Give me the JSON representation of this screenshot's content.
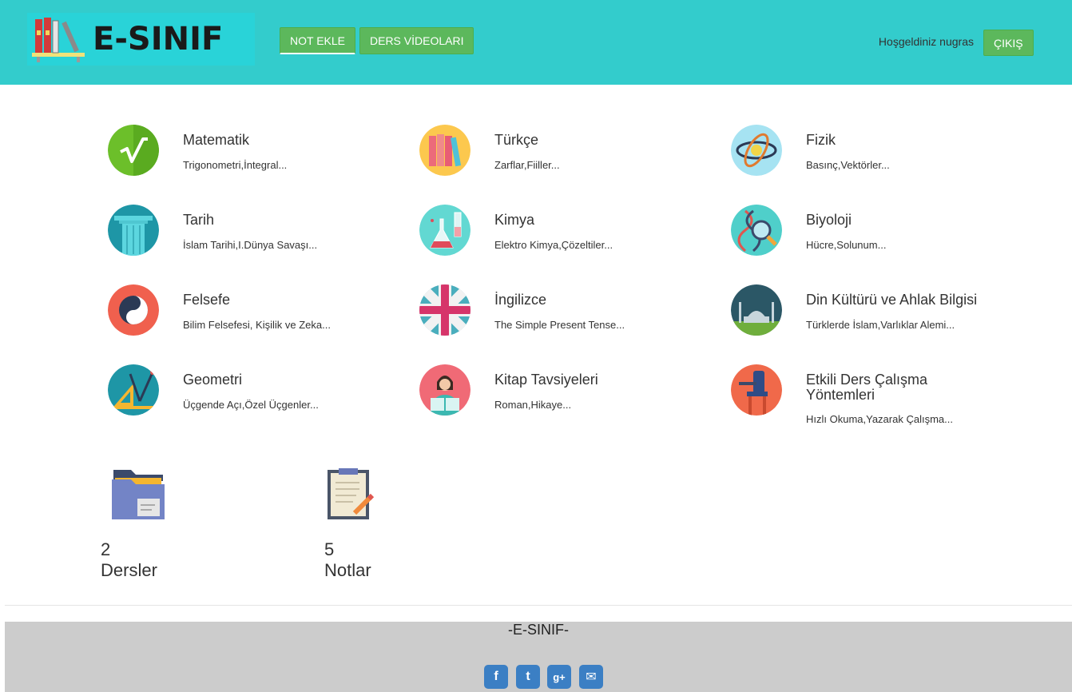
{
  "header": {
    "logo_text": "E-SINIF",
    "nav": [
      {
        "label": "NOT EKLE"
      },
      {
        "label": "DERS VİDEOLARI"
      }
    ],
    "welcome": "Hoşgeldiniz nugras",
    "logout": "ÇIKIŞ"
  },
  "subjects": [
    {
      "title": "Matematik",
      "desc": "Trigonometri,İntegral...",
      "icon": "square-root-icon"
    },
    {
      "title": "Türkçe",
      "desc": "Zarflar,Fiiller...",
      "icon": "books-icon"
    },
    {
      "title": "Fizik",
      "desc": "Basınç,Vektörler...",
      "icon": "atom-icon"
    },
    {
      "title": "Tarih",
      "desc": "İslam Tarihi,I.Dünya Savaşı...",
      "icon": "column-icon"
    },
    {
      "title": "Kimya",
      "desc": "Elektro Kimya,Çözeltiler...",
      "icon": "flask-icon"
    },
    {
      "title": "Biyoloji",
      "desc": "Hücre,Solunum...",
      "icon": "dna-magnifier-icon"
    },
    {
      "title": "Felsefe",
      "desc": "Bilim Felsefesi, Kişilik ve Zeka...",
      "icon": "yin-yang-icon"
    },
    {
      "title": "İngilizce",
      "desc": "The Simple Present Tense...",
      "icon": "uk-flag-icon"
    },
    {
      "title": "Din Kültürü ve Ahlak Bilgisi",
      "desc": "Türklerde İslam,Varlıklar Alemi...",
      "icon": "mosque-icon"
    },
    {
      "title": "Geometri",
      "desc": "Üçgende Açı,Özel Üçgenler...",
      "icon": "set-square-icon"
    },
    {
      "title": "Kitap Tavsiyeleri",
      "desc": "Roman,Hikaye...",
      "icon": "reader-icon"
    },
    {
      "title": "Etkili Ders Çalışma Yöntemleri",
      "desc": "Hızlı Okuma,Yazarak Çalışma...",
      "icon": "desk-chair-icon"
    }
  ],
  "stats": [
    {
      "count": "2",
      "label": "Dersler",
      "icon": "folder-icon"
    },
    {
      "count": "5",
      "label": "Notlar",
      "icon": "clipboard-icon"
    }
  ],
  "footer": {
    "title": "-E-SINIF-",
    "social": [
      {
        "icon": "facebook-icon",
        "glyph": "f"
      },
      {
        "icon": "twitter-icon",
        "glyph": "t"
      },
      {
        "icon": "google-plus-icon",
        "glyph": "g+"
      },
      {
        "icon": "email-icon",
        "glyph": "✉"
      }
    ]
  },
  "colors": {
    "header_bg": "#33cccc",
    "button_green": "#5cb85c",
    "footer_bg": "#cccccc",
    "social_blue": "#3b7fc4"
  }
}
